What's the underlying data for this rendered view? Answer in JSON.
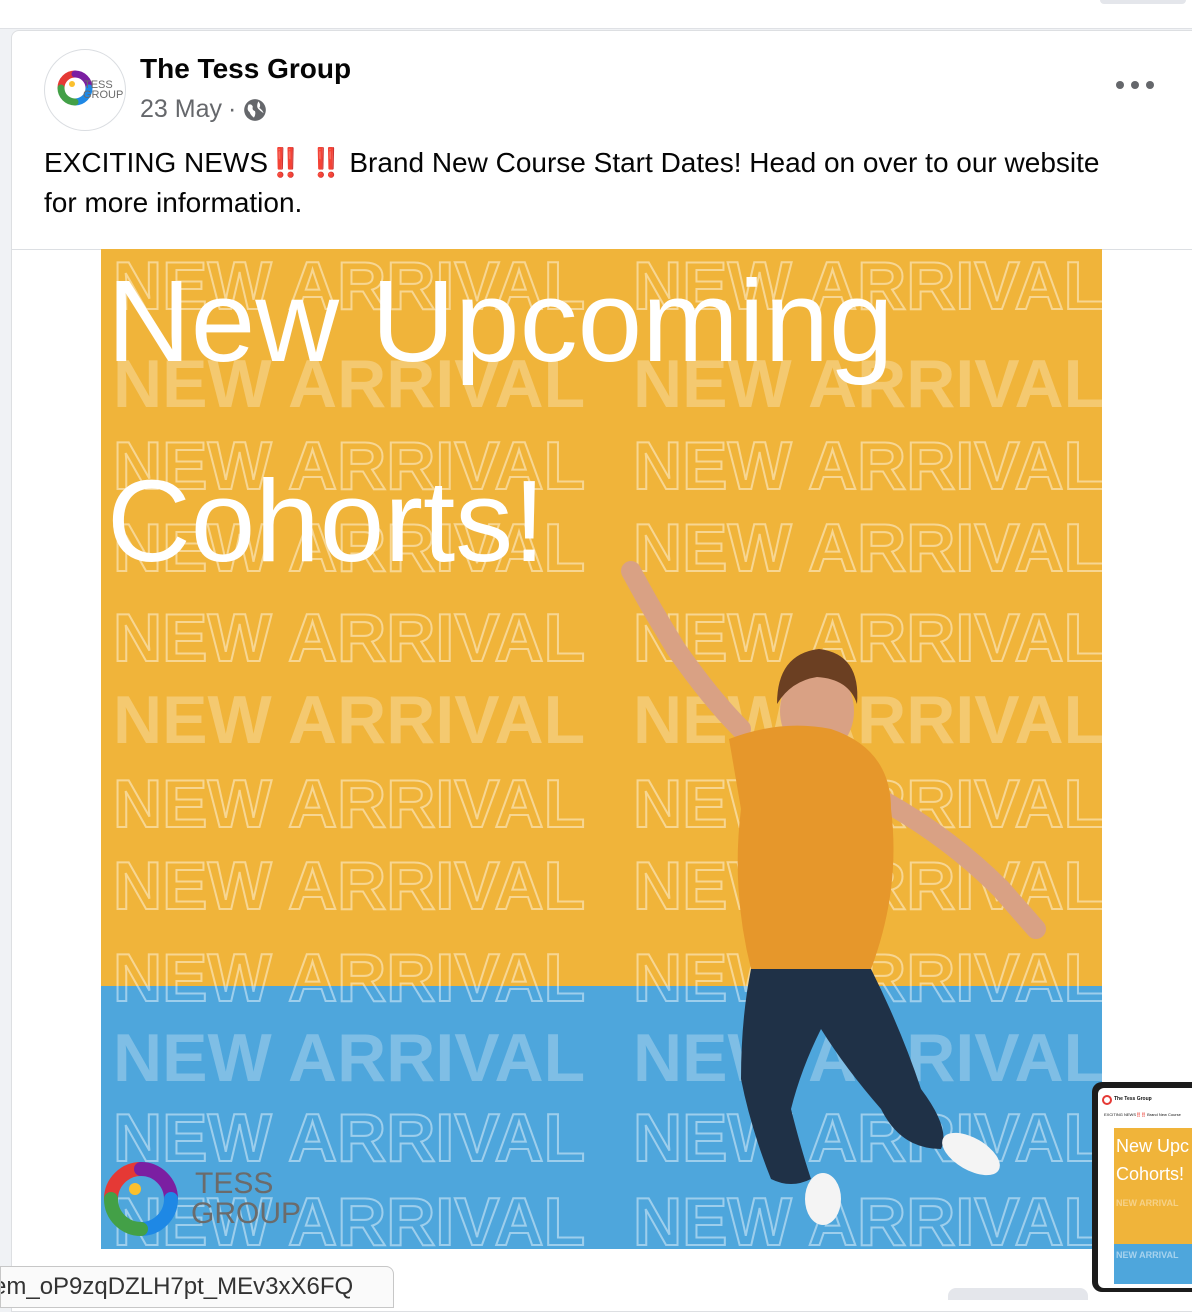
{
  "post": {
    "page_name": "The Tess Group",
    "date": "23 May",
    "separator": "·",
    "privacy_icon": "globe-icon",
    "more_icon": "more-horizontal-icon",
    "message_part1": "EXCITING NEWS",
    "bang1": "‼️",
    "bang2": "‼️",
    "message_part2": "Brand New Course Start Dates! Head on over to our website for more information."
  },
  "avatar": {
    "logo_line1": "TESS",
    "logo_line2": "GROUP"
  },
  "creative": {
    "headline_line1": "New Upcoming",
    "headline_line2": "Cohorts!",
    "background_text": "NEW ARRIVAL",
    "logo_line1": "TESS",
    "logo_line2": "GROUP",
    "colors": {
      "yellow": "#f0b43a",
      "blue": "#4ea6dc",
      "headline": "#ffffff"
    }
  },
  "thumbnail": {
    "page_name": "The Tess Group",
    "message": "EXCITING NEWS‼️‼️ Brand New Course",
    "headline_line1": "New Upc",
    "headline_line2": "Cohorts!",
    "arrival": "NEW ARRIVAL"
  },
  "status_bar": {
    "url_fragment": "em_oP9zqDZLH7pt_MEv3xX6FQ"
  }
}
